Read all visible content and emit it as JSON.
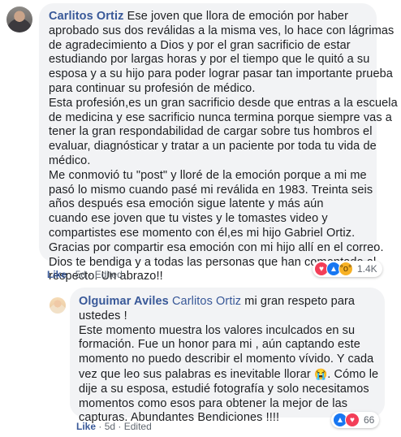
{
  "comment": {
    "author": "Carlitos Ortiz",
    "first_line": " Ese joven que llora de emoción por haber",
    "lines": [
      "aprobado sus dos reválidas a la misma ves, lo hace con lágrimas",
      "de agradecimiento a Dios y por el gran sacrificio de estar",
      "estudiando por largas horas y por el tiempo que le quitó a su",
      "esposa y a su hijo para poder lograr pasar tan importante prueba",
      "para continuar su profesión de médico.",
      "Esta profesión,es un gran sacrificio desde que entras a la escuela",
      "de medicina y ese sacrificio nunca termina porque siempre vas a",
      "tener la gran respondabilidad de cargar sobre tus hombros el",
      "evaluar, diagnósticar y tratar a un paciente por toda tu vida de",
      "médico.",
      "Me conmovió tu \"post\" y lloré de la emoción porque a mi me",
      "pasó lo mismo cuando pasé mi reválida en 1983. Treinta seis",
      "años después esa emoción sigue latente y más aún",
      "cuando ese joven que tu vistes y le tomastes video y",
      "compartistes ese momento con él,es mi hijo Gabriel Ortiz.",
      "Gracias por compartir esa emoción con mi hijo allí en el correo.",
      "Dios te bendiga y a todas las personas que han comentado al",
      "respecto. Un abrazo!!"
    ],
    "like_label": "Like",
    "sep": " · ",
    "time": "5d",
    "edited": "Edited",
    "reaction_count": "1.4K",
    "reaction_icons": [
      "love-icon",
      "like-icon",
      "wow-icon"
    ]
  },
  "reply": {
    "author": "Olguimar Aviles",
    "mention": "Carlitos Ortiz",
    "first_line": " mi gran respeto para",
    "lines": [
      "ustedes !",
      "Este momento muestra los valores inculcados en su",
      "formación. Fue un honor para mi , aún captando este",
      "momento no puedo describir el momento vívido. Y cada",
      "vez que leo sus palabras es inevitable llorar",
      "dije a su esposa, estudié fotografía y solo necesitamos",
      "momentos como esos para obtener la mejor de las",
      "capturas. Abundantes Bendiciones !!!!"
    ],
    "line5_tail": ". Cómo le",
    "emoji": "😭",
    "like_label": "Like",
    "sep": " · ",
    "time": "5d",
    "edited": "Edited",
    "reaction_count": "66",
    "reaction_icons": [
      "like-icon",
      "love-icon"
    ]
  },
  "colors": {
    "name": "#385898",
    "bubble": "#f2f3f5",
    "love": "#f33e58",
    "like": "#1877f2",
    "wow": "#f7b125"
  }
}
